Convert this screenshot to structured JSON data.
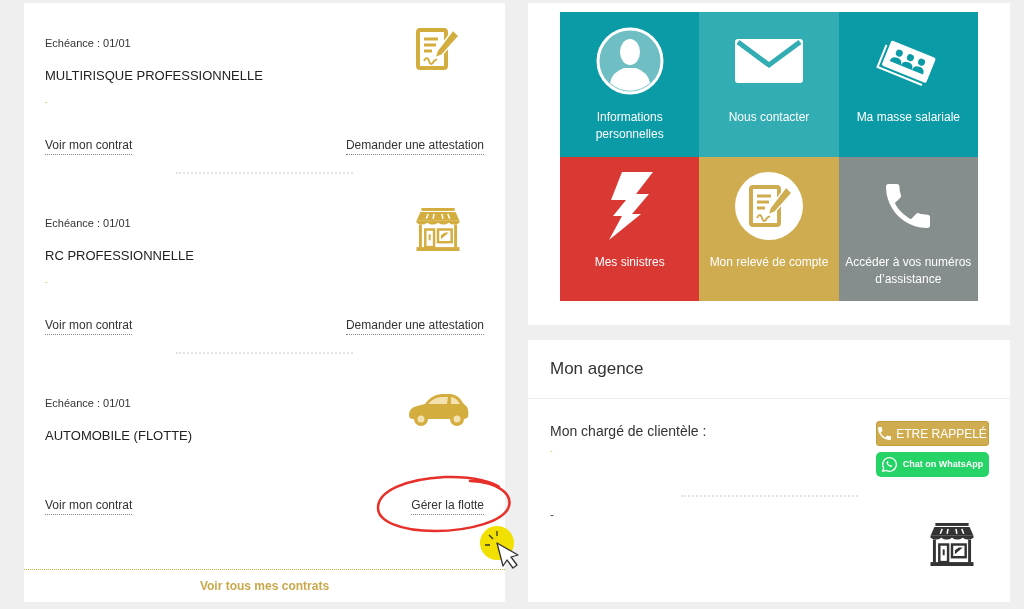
{
  "contracts": [
    {
      "kind": "multirisk",
      "due_date": "Echéance : 01/01",
      "title": "MULTIRISQUE PROFESSIONNELLE",
      "note": "-",
      "links": [
        {
          "label": "Voir mon contrat",
          "highlighted": false
        },
        {
          "label": "Demander une attestation",
          "highlighted": false
        }
      ]
    },
    {
      "kind": "liability",
      "due_date": "Echéance : 01/01",
      "title": "RC PROFESSIONNELLE",
      "note": "-",
      "links": [
        {
          "label": "Voir mon contrat",
          "highlighted": false
        },
        {
          "label": "Demander une attestation",
          "highlighted": false
        }
      ]
    },
    {
      "kind": "fleet",
      "due_date": "Echéance : 01/01",
      "title": "AUTOMOBILE (FLOTTE)",
      "links": [
        {
          "label": "Voir mon contrat",
          "highlighted": false
        },
        {
          "label": "Gérer la flotte",
          "highlighted": true
        }
      ]
    }
  ],
  "all_contracts_link": "Voir tous mes contrats",
  "shortcuts": [
    {
      "kind": "profile",
      "label": "Informations personnelles",
      "color": "#0a9ba6"
    },
    {
      "kind": "contact",
      "label": "Nous contacter",
      "color": "#32adb3"
    },
    {
      "kind": "payroll",
      "label": "Ma masse salariale",
      "color": "#0a9ba6"
    },
    {
      "kind": "claims",
      "label": "Mes sinistres",
      "color": "#d93833"
    },
    {
      "kind": "statement",
      "label": "Mon relevé de compte",
      "color": "#cfac50"
    },
    {
      "kind": "assistance",
      "label": "Accéder à vos numéros d’assistance",
      "color": "#868d8d"
    }
  ],
  "agency": {
    "title": "Mon agence",
    "advisor_label": "Mon chargé de clientèle :",
    "advisor_note": "-",
    "buttons": [
      {
        "kind": "callback",
        "label": "ETRE RAPPELÉ"
      },
      {
        "kind": "whatsapp",
        "label": "Chat on WhatsApp"
      }
    ],
    "note": "-"
  }
}
